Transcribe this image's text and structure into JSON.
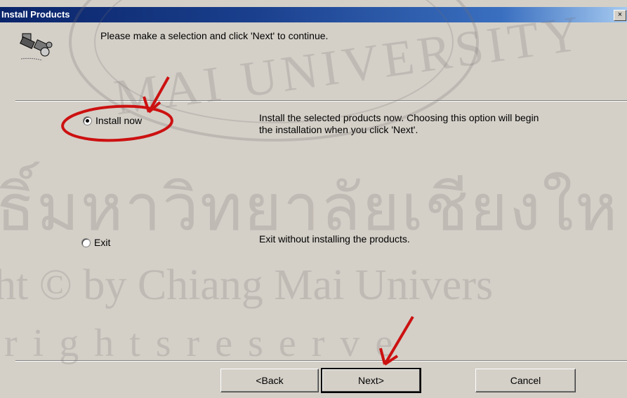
{
  "window": {
    "title": "Install Products",
    "close_label": "×"
  },
  "header": {
    "instruction": "Please make a selection and click 'Next' to continue."
  },
  "options": [
    {
      "label": "Install now",
      "selected": true,
      "description": "Install the selected products now.  Choosing this option will begin the installation when you click 'Next'."
    },
    {
      "label": "Exit",
      "selected": false,
      "description": "Exit without installing the products."
    }
  ],
  "buttons": {
    "back": "<Back",
    "next": "Next>",
    "cancel": "Cancel"
  },
  "watermark": {
    "seal_text": "MAI UNIVERSITY",
    "thai_text": "ธิ์มหาวิทยาลัยเชียงให",
    "copyright_text": "ht © by Chiang Mai Univers",
    "reserved_text": "r i g h t s   r e s e r v e"
  },
  "colors": {
    "window_bg": "#d4d0c8",
    "titlebar": "#0a246a",
    "annotation": "#cc1111"
  }
}
